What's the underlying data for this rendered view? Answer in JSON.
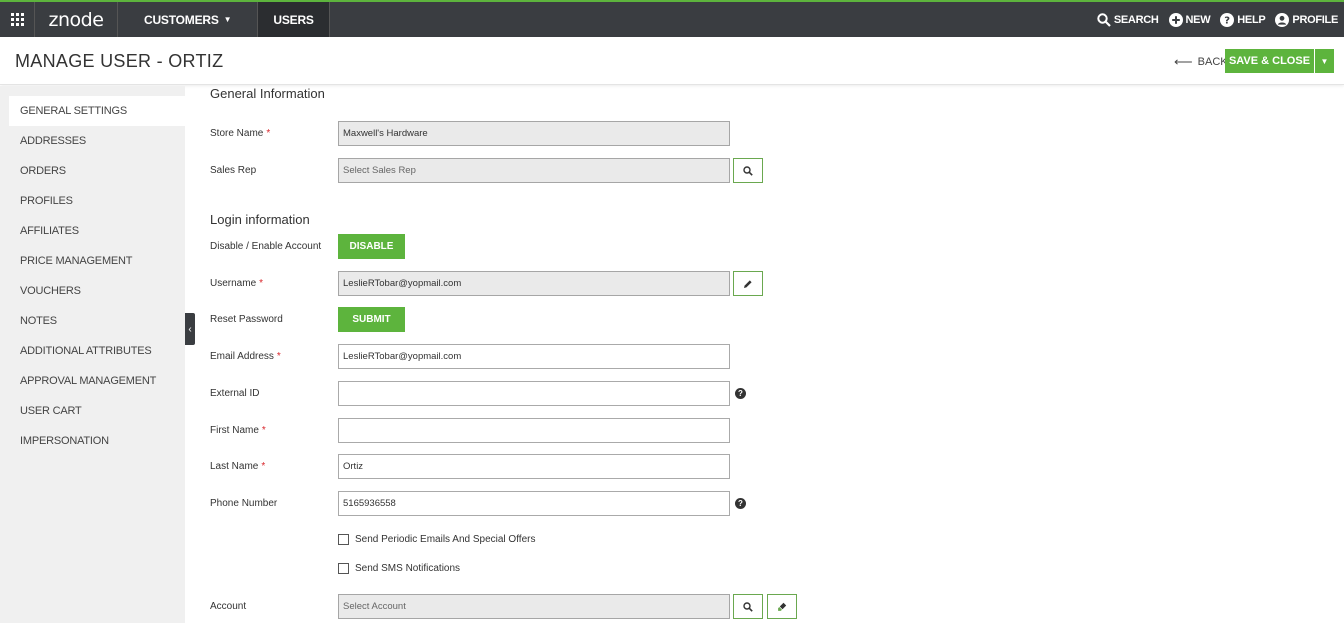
{
  "topnav": {
    "logo": "znode",
    "items": [
      {
        "label": "CUSTOMERS",
        "has_caret": true
      },
      {
        "label": "USERS",
        "active": true
      }
    ],
    "right": [
      {
        "label": "SEARCH",
        "icon": "search-icon"
      },
      {
        "label": "NEW",
        "icon": "plus-circle-icon"
      },
      {
        "label": "HELP",
        "icon": "question-circle-icon"
      },
      {
        "label": "PROFILE",
        "icon": "user-circle-icon"
      }
    ]
  },
  "header": {
    "title": "MANAGE USER - ORTIZ",
    "back_label": "BACK",
    "save_label": "SAVE & CLOSE"
  },
  "sidebar": {
    "items": [
      {
        "label": "GENERAL SETTINGS",
        "active": true
      },
      {
        "label": "ADDRESSES"
      },
      {
        "label": "ORDERS"
      },
      {
        "label": "PROFILES"
      },
      {
        "label": "AFFILIATES"
      },
      {
        "label": "PRICE MANAGEMENT"
      },
      {
        "label": "VOUCHERS"
      },
      {
        "label": "NOTES"
      },
      {
        "label": "ADDITIONAL ATTRIBUTES"
      },
      {
        "label": "APPROVAL MANAGEMENT"
      },
      {
        "label": "USER CART"
      },
      {
        "label": "IMPERSONATION"
      }
    ]
  },
  "form": {
    "general_title": "General Information",
    "store_name": {
      "label": "Store Name",
      "value": "Maxwell's Hardware"
    },
    "sales_rep": {
      "label": "Sales Rep",
      "placeholder": "Select Sales Rep"
    },
    "login_title": "Login information",
    "account_toggle": {
      "label": "Disable / Enable Account",
      "button": "DISABLE"
    },
    "username": {
      "label": "Username",
      "value": "LeslieRTobar@yopmail.com"
    },
    "reset_password": {
      "label": "Reset Password",
      "button": "SUBMIT"
    },
    "email": {
      "label": "Email Address",
      "value": "LeslieRTobar@yopmail.com"
    },
    "external_id": {
      "label": "External ID",
      "value": ""
    },
    "first_name": {
      "label": "First Name",
      "value": ""
    },
    "last_name": {
      "label": "Last Name",
      "value": "Ortiz"
    },
    "phone": {
      "label": "Phone Number",
      "value": "5165936558"
    },
    "periodic_emails": {
      "label": "Send Periodic Emails And Special Offers",
      "checked": false
    },
    "sms": {
      "label": "Send SMS Notifications",
      "checked": false
    },
    "account": {
      "label": "Account",
      "placeholder": "Select Account"
    },
    "required_mark": "*",
    "help_glyph": "?"
  },
  "colors": {
    "brand_green": "#5db43d",
    "nav_dark": "#3a3d41",
    "required_red": "#d9262b"
  }
}
